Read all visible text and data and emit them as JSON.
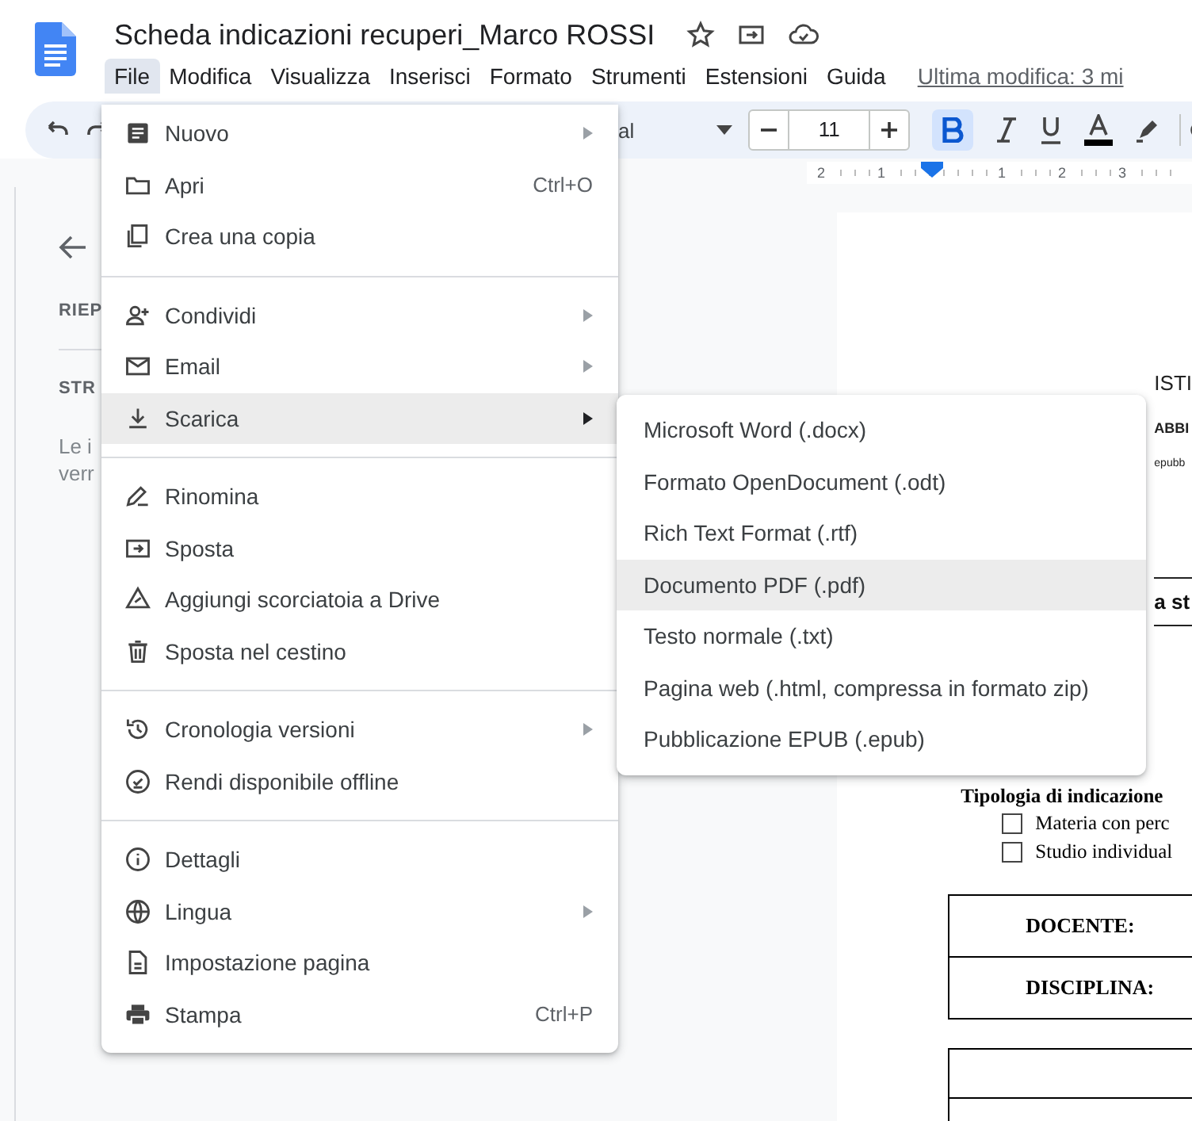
{
  "doc_title": "Scheda indicazioni recuperi_Marco ROSSI",
  "menubar": [
    {
      "label": "File",
      "selected": true
    },
    {
      "label": "Modifica",
      "selected": false
    },
    {
      "label": "Visualizza",
      "selected": false
    },
    {
      "label": "Inserisci",
      "selected": false
    },
    {
      "label": "Formato",
      "selected": false
    },
    {
      "label": "Strumenti",
      "selected": false
    },
    {
      "label": "Estensioni",
      "selected": false
    },
    {
      "label": "Guida",
      "selected": false
    }
  ],
  "last_edit": "Ultima modifica: 3 mi",
  "toolbar": {
    "font": "al",
    "font_size": "11",
    "bold_on": true
  },
  "ruler": {
    "labels": [
      "2",
      "1",
      "1",
      "2",
      "3"
    ]
  },
  "outline": {
    "headings": [
      "RIEP",
      "STR"
    ],
    "text_lines": [
      "Le i",
      "verr"
    ]
  },
  "document": {
    "header_lines": [
      "ISTI",
      "ABBI",
      "epubb"
    ],
    "section_title": "a st",
    "type_label": "Tipologia di indicazione",
    "options": [
      {
        "label": "Materia con perc",
        "checked": false
      },
      {
        "label": "Studio individual",
        "checked": false
      }
    ],
    "table_rows": [
      "DOCENTE:",
      "DISCIPLINA:"
    ]
  },
  "file_menu": {
    "groups": [
      [
        {
          "label": "Nuovo",
          "submenu": true,
          "selected": false
        },
        {
          "label": "Apri",
          "shortcut": "Ctrl+O",
          "selected": false
        },
        {
          "label": "Crea una copia",
          "selected": false
        }
      ],
      [
        {
          "label": "Condividi",
          "submenu": true,
          "selected": false
        },
        {
          "label": "Email",
          "submenu": true,
          "selected": false
        },
        {
          "label": "Scarica",
          "submenu": true,
          "selected": true
        }
      ],
      [
        {
          "label": "Rinomina",
          "selected": false
        },
        {
          "label": "Sposta",
          "selected": false
        },
        {
          "label": "Aggiungi scorciatoia a Drive",
          "selected": false
        },
        {
          "label": "Sposta nel cestino",
          "selected": false
        }
      ],
      [
        {
          "label": "Cronologia versioni",
          "submenu": true,
          "selected": false
        },
        {
          "label": "Rendi disponibile offline",
          "selected": false
        }
      ],
      [
        {
          "label": "Dettagli",
          "selected": false
        },
        {
          "label": "Lingua",
          "submenu": true,
          "selected": false
        },
        {
          "label": "Impostazione pagina",
          "selected": false
        },
        {
          "label": "Stampa",
          "shortcut": "Ctrl+P",
          "selected": false
        }
      ]
    ]
  },
  "download_menu": {
    "items": [
      {
        "label": "Microsoft Word (.docx)",
        "selected": false
      },
      {
        "label": "Formato OpenDocument (.odt)",
        "selected": false
      },
      {
        "label": "Rich Text Format (.rtf)",
        "selected": false
      },
      {
        "label": "Documento PDF (.pdf)",
        "selected": true
      },
      {
        "label": "Testo normale (.txt)",
        "selected": false
      },
      {
        "label": "Pagina web (.html, compressa in formato zip)",
        "selected": false
      },
      {
        "label": "Pubblicazione EPUB (.epub)",
        "selected": false
      }
    ]
  }
}
